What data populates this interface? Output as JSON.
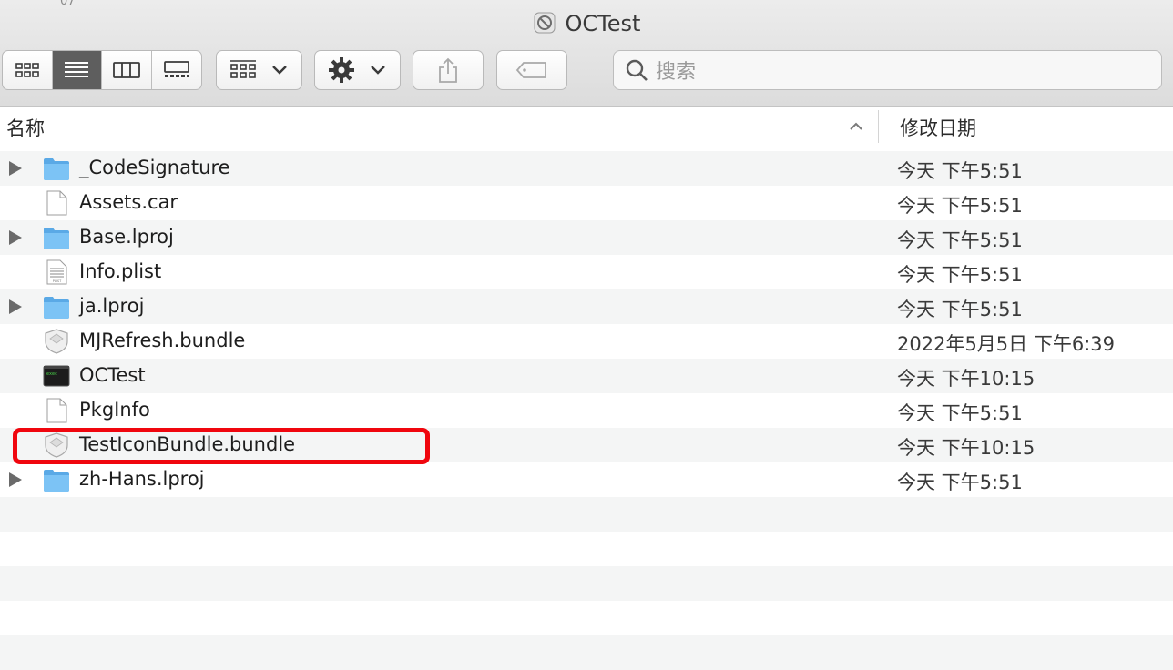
{
  "window": {
    "stray_text": "07",
    "title": "OCTest",
    "title_icon": "app-disabled-icon"
  },
  "toolbar": {
    "view_modes": [
      {
        "name": "icon-view",
        "icon": "grid-icon",
        "active": false
      },
      {
        "name": "list-view",
        "icon": "list-icon",
        "active": true
      },
      {
        "name": "column-view",
        "icon": "columns-icon",
        "active": false
      },
      {
        "name": "gallery-view",
        "icon": "gallery-icon",
        "active": false
      }
    ],
    "group_icon": "group-by-icon",
    "action_icon": "gear-icon",
    "share_icon": "share-icon",
    "tag_icon": "tag-icon",
    "search_placeholder": "搜索"
  },
  "columns": {
    "name": "名称",
    "date": "修改日期"
  },
  "files": [
    {
      "name": "_CodeSignature",
      "date": "今天 下午5:51",
      "kind": "folder",
      "expandable": true
    },
    {
      "name": "Assets.car",
      "date": "今天 下午5:51",
      "kind": "document",
      "expandable": false
    },
    {
      "name": "Base.lproj",
      "date": "今天 下午5:51",
      "kind": "folder",
      "expandable": true
    },
    {
      "name": "Info.plist",
      "date": "今天 下午5:51",
      "kind": "plist",
      "expandable": false
    },
    {
      "name": "ja.lproj",
      "date": "今天 下午5:51",
      "kind": "folder",
      "expandable": true
    },
    {
      "name": "MJRefresh.bundle",
      "date": "2022年5月5日 下午6:39",
      "kind": "bundle",
      "expandable": false
    },
    {
      "name": "OCTest",
      "date": "今天 下午10:15",
      "kind": "executable",
      "expandable": false
    },
    {
      "name": "PkgInfo",
      "date": "今天 下午5:51",
      "kind": "document",
      "expandable": false
    },
    {
      "name": "TestIconBundle.bundle",
      "date": "今天 下午10:15",
      "kind": "bundle",
      "expandable": false,
      "highlighted": true
    },
    {
      "name": "zh-Hans.lproj",
      "date": "今天 下午5:51",
      "kind": "folder",
      "expandable": true
    }
  ],
  "colors": {
    "folder": "#6ab8ef",
    "highlight": "#f0060e",
    "stripe": "#f4f5f5"
  }
}
